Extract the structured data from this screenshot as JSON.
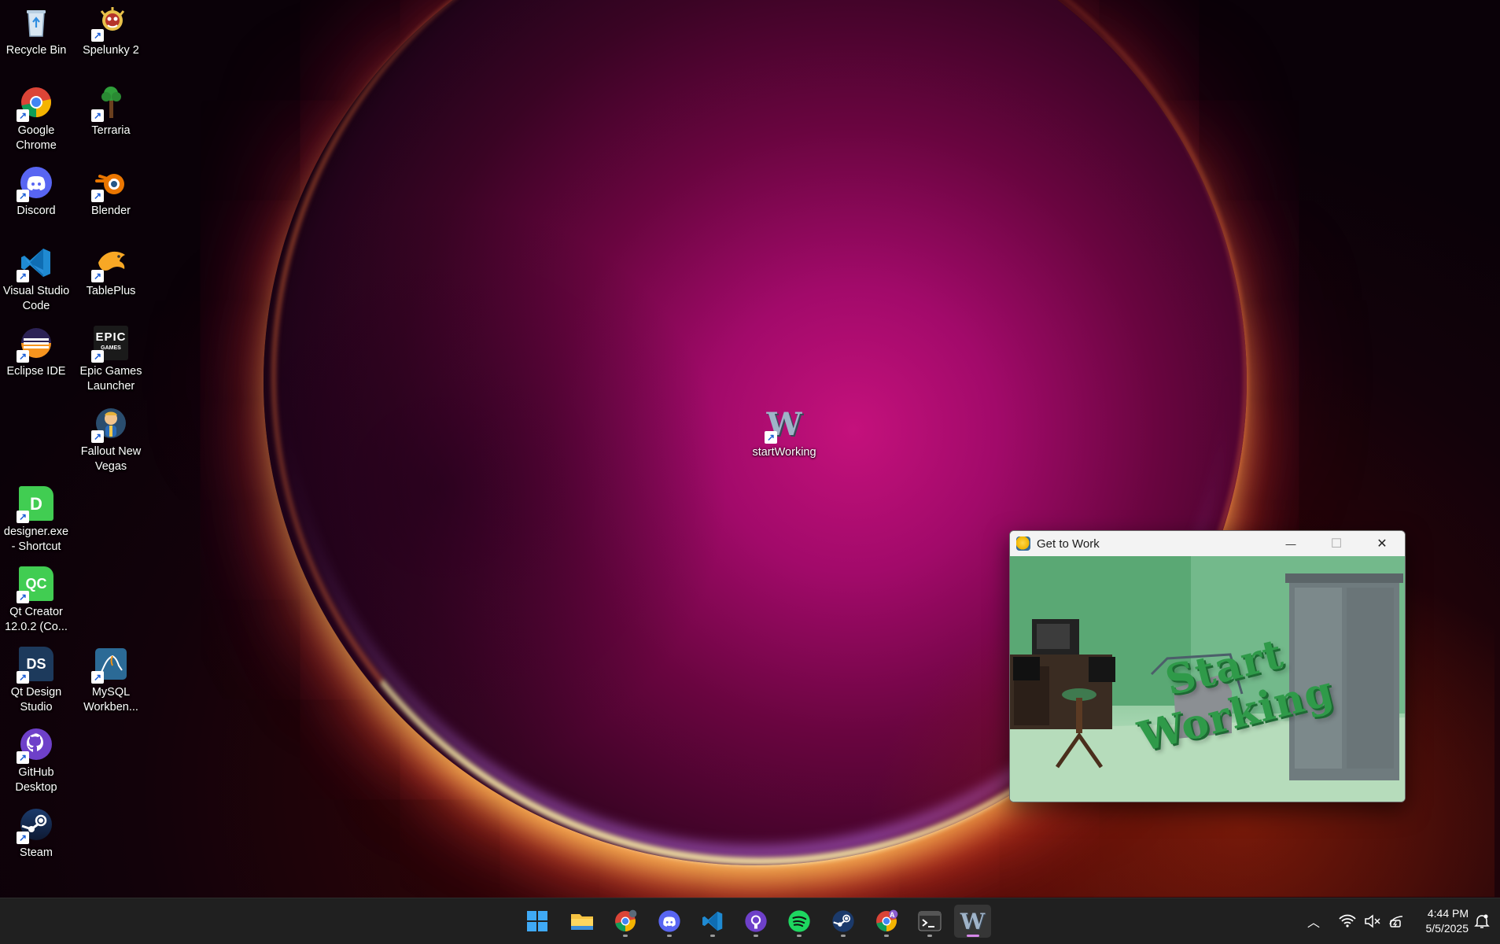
{
  "desktop": {
    "icons": [
      {
        "label": "Recycle Bin",
        "icon": "recycle-bin-icon"
      },
      {
        "label": "Spelunky 2",
        "icon": "spelunky-icon"
      },
      {
        "label": "Google Chrome",
        "icon": "chrome-icon"
      },
      {
        "label": "Terraria",
        "icon": "terraria-icon"
      },
      {
        "label": "Discord",
        "icon": "discord-icon"
      },
      {
        "label": "Blender",
        "icon": "blender-icon"
      },
      {
        "label": "Visual Studio Code",
        "icon": "vscode-icon"
      },
      {
        "label": "TablePlus",
        "icon": "tableplus-icon"
      },
      {
        "label": "Eclipse IDE",
        "icon": "eclipse-icon"
      },
      {
        "label": "Epic Games Launcher",
        "icon": "epic-games-icon"
      },
      {
        "label": "Fallout New Vegas",
        "icon": "fallout-icon"
      },
      {
        "label": "designer.exe - Shortcut",
        "icon": "qt-designer-icon"
      },
      {
        "label": "Qt Creator 12.0.2 (Co...",
        "icon": "qt-creator-icon"
      },
      {
        "label": "Qt Design Studio",
        "icon": "qt-design-studio-icon"
      },
      {
        "label": "MySQL Workben...",
        "icon": "mysql-workbench-icon"
      },
      {
        "label": "GitHub Desktop",
        "icon": "github-desktop-icon"
      },
      {
        "label": "Steam",
        "icon": "steam-icon"
      },
      {
        "label": "startWorking",
        "icon": "start-working-icon"
      }
    ],
    "epic_logo_text": "EPIC",
    "epic_logo_sub": "GAMES",
    "startworking_glyph": "W",
    "qt_designer_glyph": "D",
    "qt_creator_glyph": "QC",
    "qt_design_studio_glyph": "DS"
  },
  "window": {
    "title": "Get to Work",
    "minimize_glyph": "—",
    "maximize_glyph": "☐",
    "close_glyph": "✕",
    "scene_text": "Start Working"
  },
  "taskbar": {
    "apps": [
      {
        "icon": "windows-start-icon"
      },
      {
        "icon": "file-explorer-icon"
      },
      {
        "icon": "chrome-icon"
      },
      {
        "icon": "discord-icon"
      },
      {
        "icon": "vscode-icon"
      },
      {
        "icon": "github-desktop-icon"
      },
      {
        "icon": "spotify-icon"
      },
      {
        "icon": "steam-icon"
      },
      {
        "icon": "chrome-profile-icon"
      },
      {
        "icon": "terminal-icon"
      },
      {
        "icon": "start-working-icon"
      }
    ],
    "chrome_profile_badge": "A",
    "time": "4:44 PM",
    "date": "5/5/2025"
  },
  "colors": {
    "taskbar_bg": "#202020",
    "active_indicator": "#d686e8",
    "scene_text": "#2f9a49"
  }
}
